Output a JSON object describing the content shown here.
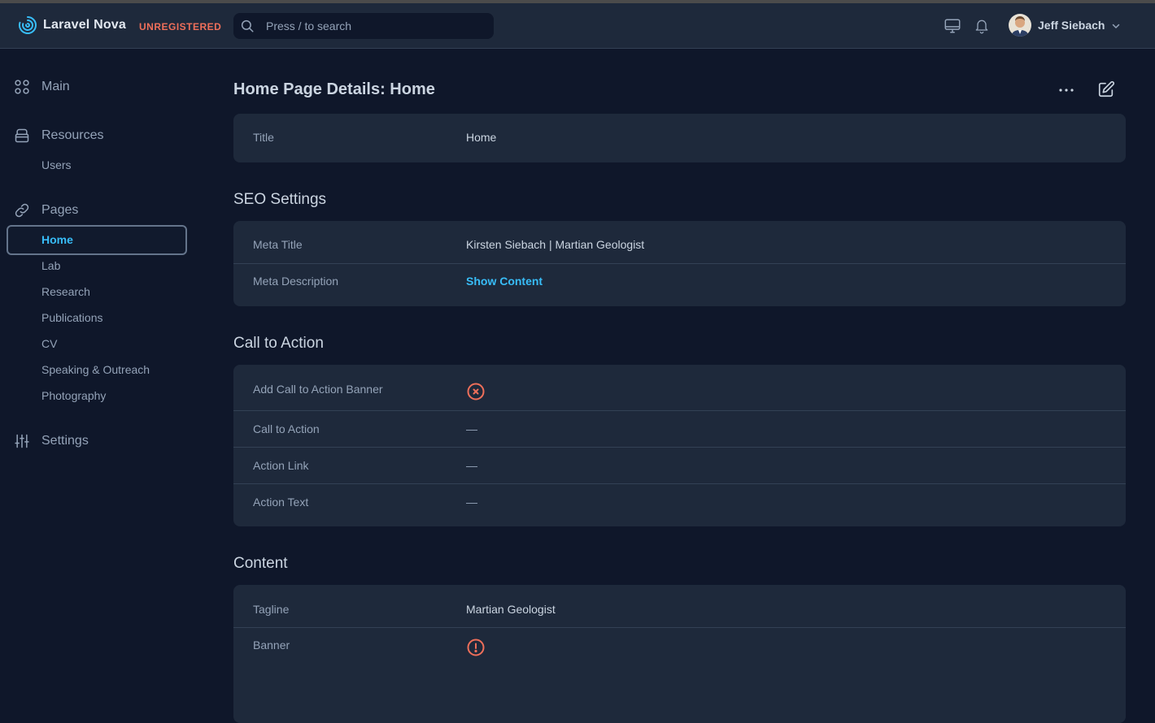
{
  "app": {
    "name": "Laravel Nova",
    "license_badge": "UNREGISTERED",
    "accent_color": "#38bdf8",
    "danger_color": "#ef6f5a"
  },
  "search": {
    "placeholder": "Press / to search",
    "icon": "search-icon"
  },
  "topbar": {
    "icons": [
      "monitor-icon",
      "bell-icon"
    ],
    "user": {
      "name": "Jeff Siebach",
      "icon": "chevron-down-icon"
    }
  },
  "sidebar": {
    "sections": [
      {
        "label": "Main",
        "icon": "grid-icon"
      },
      {
        "label": "Resources",
        "icon": "archive-icon",
        "items": [
          "Users"
        ]
      },
      {
        "label": "Pages",
        "icon": "link-icon",
        "items": [
          "Home",
          "Lab",
          "Research",
          "Publications",
          "CV",
          "Speaking & Outreach",
          "Photography"
        ],
        "active": "Home"
      },
      {
        "label": "Settings",
        "icon": "sliders-icon"
      }
    ]
  },
  "page": {
    "title": "Home Page Details: Home",
    "actions": [
      "more-icon",
      "edit-icon"
    ]
  },
  "details": {
    "title_label": "Title",
    "title_value": "Home"
  },
  "seo": {
    "heading": "SEO Settings",
    "meta_title_label": "Meta Title",
    "meta_title_value": "Kirsten Siebach | Martian Geologist",
    "meta_description_label": "Meta Description",
    "meta_description_value": "Show Content"
  },
  "cta": {
    "heading": "Call to Action",
    "banner_label": "Add Call to Action Banner",
    "banner_value_icon": "x-circle-icon",
    "cta_label": "Call to Action",
    "cta_value": "—",
    "link_label": "Action Link",
    "link_value": "—",
    "text_label": "Action Text",
    "text_value": "—"
  },
  "content": {
    "heading": "Content",
    "tagline_label": "Tagline",
    "tagline_value": "Martian Geologist",
    "banner_label": "Banner",
    "banner_value_icon": "alert-circle-icon"
  }
}
